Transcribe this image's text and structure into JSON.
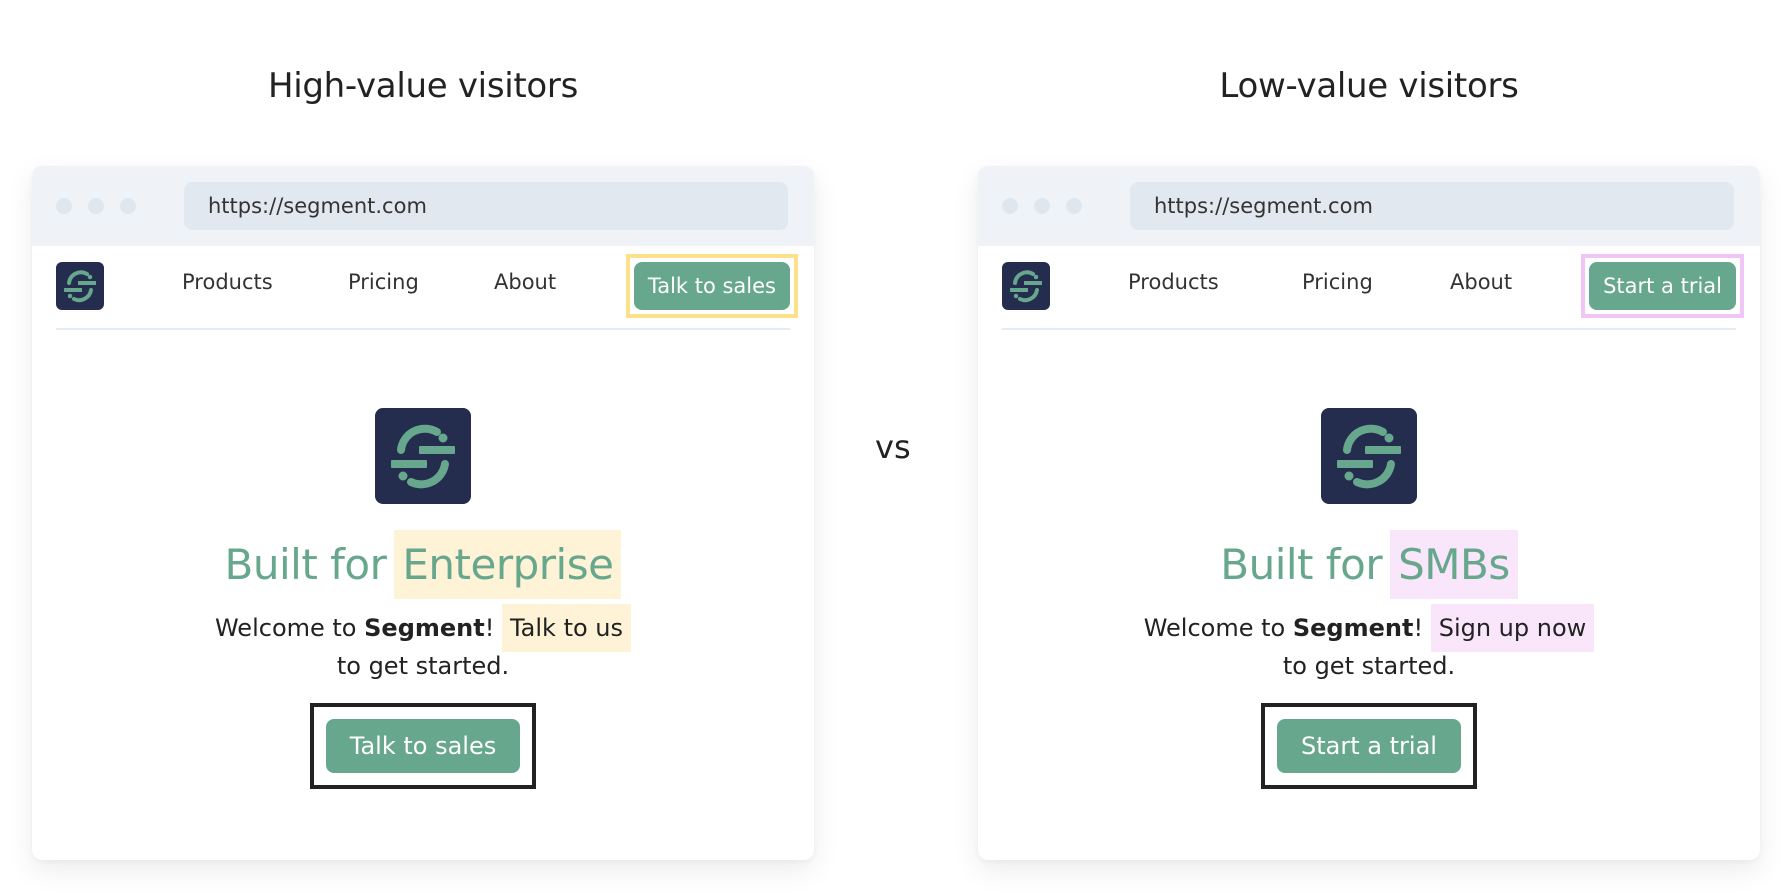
{
  "columns": [
    {
      "title": "High-value visitors",
      "url": "https://segment.com",
      "nav_links": [
        "Products",
        "Pricing",
        "About"
      ],
      "nav_cta": "Talk to sales",
      "highlight_color": "#fde08a",
      "headline_prefix": "Built for",
      "headline_highlight": "Enterprise",
      "welcome_prefix": "Welcome to ",
      "welcome_brand": "Segment",
      "welcome_bang": "!",
      "welcome_highlight": "Talk to us",
      "welcome_suffix": " to get started.",
      "hero_cta": "Talk to sales"
    },
    {
      "title": "Low-value visitors",
      "url": "https://segment.com",
      "nav_links": [
        "Products",
        "Pricing",
        "About"
      ],
      "nav_cta": "Start a trial",
      "highlight_color": "#efc6f5",
      "headline_prefix": "Built for",
      "headline_highlight": "SMBs",
      "welcome_prefix": "Welcome to ",
      "welcome_brand": "Segment",
      "welcome_bang": "!",
      "welcome_highlight": "Sign up now",
      "welcome_suffix": " to get started.",
      "hero_cta": "Start a trial"
    }
  ],
  "separator": "vs",
  "colors": {
    "brand_green": "#67a78d",
    "brand_navy": "#242d4e",
    "highlight_yellow_bg": "#fef3d7",
    "highlight_pink_bg": "#f9e6fb"
  }
}
